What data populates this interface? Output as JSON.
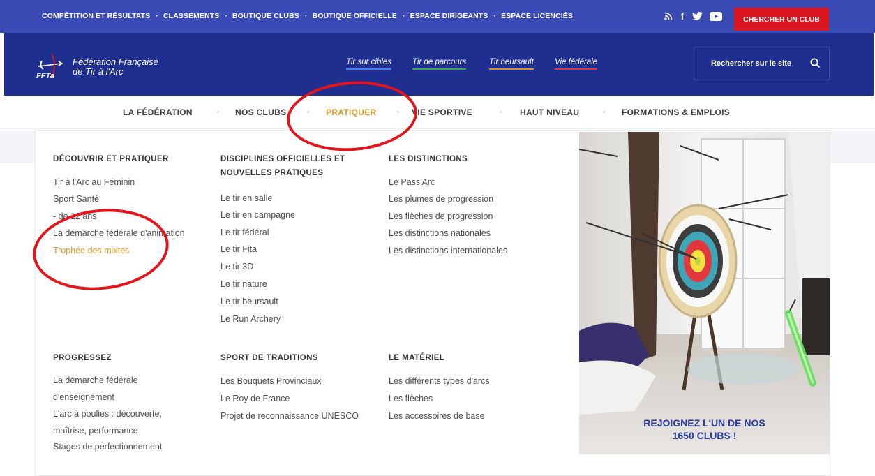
{
  "topbar": {
    "links": [
      "COMPÉTITION ET RÉSULTATS",
      "CLASSEMENTS",
      "BOUTIQUE CLUBS",
      "BOUTIQUE OFFICIELLE",
      "ESPACE DIRIGEANTS",
      "ESPACE LICENCIÉS"
    ],
    "social_icons": [
      "rss-icon",
      "facebook-icon",
      "twitter-icon",
      "youtube-icon"
    ],
    "cta": "CHERCHER UN CLUB"
  },
  "brand": {
    "line1": "Fédération Française",
    "line2": "de Tir à l'Arc",
    "logo_text": "FFTa",
    "disciplines": [
      {
        "label": "Tir sur cibles",
        "color": "#3f7ff0"
      },
      {
        "label": "Tir de parcours",
        "color": "#3ca64a"
      },
      {
        "label": "Tir beursault",
        "color": "#e8921f"
      },
      {
        "label": "Vie fédérale",
        "color": "#e8303a"
      }
    ],
    "search_label": "Rechercher sur le site"
  },
  "nav": {
    "items": [
      "LA FÉDÉRATION",
      "NOS CLUBS",
      "PRATIQUER",
      "VIE SPORTIVE",
      "HAUT NIVEAU",
      "FORMATIONS & EMPLOIS"
    ],
    "active": "PRATIQUER",
    "active_color": "#e09a2a"
  },
  "menu": {
    "col1_top": {
      "heading": "DÉCOUVRIR ET PRATIQUER",
      "links": [
        "Tir à l'Arc au Féminin",
        "Sport Santé",
        "- de 12 ans",
        "La démarche fédérale d'animation",
        "Trophée des mixtes"
      ]
    },
    "col2_top": {
      "heading_line1": "DISCIPLINES OFFICIELLES ET",
      "heading_line2": "NOUVELLES PRATIQUES",
      "links": [
        "Le tir en salle",
        "Le tir en campagne",
        "Le tir fédéral",
        "Le tir Fita",
        "Le tir 3D",
        "Le tir nature",
        "Le tir beursault",
        "Le Run Archery"
      ]
    },
    "col3_top": {
      "heading": "LES DISTINCTIONS",
      "links": [
        "Le Pass'Arc",
        "Les plumes de progression",
        "Les flèches de progression",
        "Les distinctions nationales",
        "Les distinctions internationales"
      ]
    },
    "col1_bottom": {
      "heading": "PROGRESSEZ",
      "links": [
        "La démarche fédérale d'enseignement",
        "L'arc à poulies : découverte, maîtrise, performance",
        "Stages de perfectionnement"
      ]
    },
    "col2_bottom": {
      "heading": "SPORT DE TRADITIONS",
      "links": [
        "Les Bouquets Provinciaux",
        "Le Roy de France",
        "Projet de reconnaissance UNESCO"
      ]
    },
    "col3_bottom": {
      "heading": "LE MATÉRIEL",
      "links": [
        "Les différents types d'arcs",
        "Les flèches",
        "Les accessoires de base"
      ]
    }
  },
  "promo": {
    "line1": "REJOIGNEZ L'UN DE NOS",
    "line2": "1650 CLUBS !"
  },
  "colors": {
    "topbar": "#3a4ab4",
    "brandbar": "#1f2f8f",
    "cta": "#d8151f",
    "annotation": "#e3141b"
  }
}
